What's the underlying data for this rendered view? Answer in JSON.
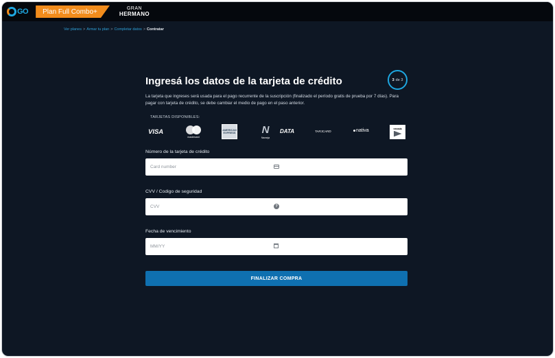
{
  "header": {
    "logo_text": "GO",
    "plan_badge": "Plan Full Combo+",
    "brand_line1": "GRAN",
    "brand_line2": "HERMANO"
  },
  "breadcrumb": {
    "items": [
      "Ver planes",
      "Armar tu plan",
      "Completar datos"
    ],
    "current": "Contratar",
    "separator": ">"
  },
  "form": {
    "title": "Ingresá los datos de la tarjeta de crédito",
    "step_current": "3",
    "step_text": "de 3",
    "description": "La tarjeta que ingreses será usada para el pago recurrente de la suscripción (finalizado el período gratis de prueba por 7 días). Para pagar con tarjeta de crédito, se debe cambiar el medio de pago en el paso anterior.",
    "cards_label": "TARJETAS DISPONIBLES:",
    "cards": {
      "visa": "VISA",
      "mastercard": "mastercard",
      "amex": "AMERICAN EXPRESS",
      "naranja_letter": "N",
      "naranja": "Naranja",
      "data": "DATA",
      "tarjetacard": "TARJCARD",
      "nativa": "nativa",
      "nevada": "nevada"
    },
    "card_number": {
      "label": "Número de la tarjeta de crédito",
      "placeholder": "Card number",
      "icon": "credit-card-icon"
    },
    "cvv": {
      "label": "CVV / Codigo de seguridad",
      "placeholder": "CVV",
      "icon": "help-icon",
      "icon_glyph": "?"
    },
    "expiry": {
      "label": "Fecha de vencimiento",
      "placeholder": "MM/YY",
      "icon": "calendar-icon"
    },
    "submit_label": "FINALIZAR COMPRA"
  },
  "colors": {
    "background": "#0e1724",
    "accent_blue": "#1ea7e1",
    "accent_orange": "#f28c1c",
    "button": "#0f70b0"
  }
}
